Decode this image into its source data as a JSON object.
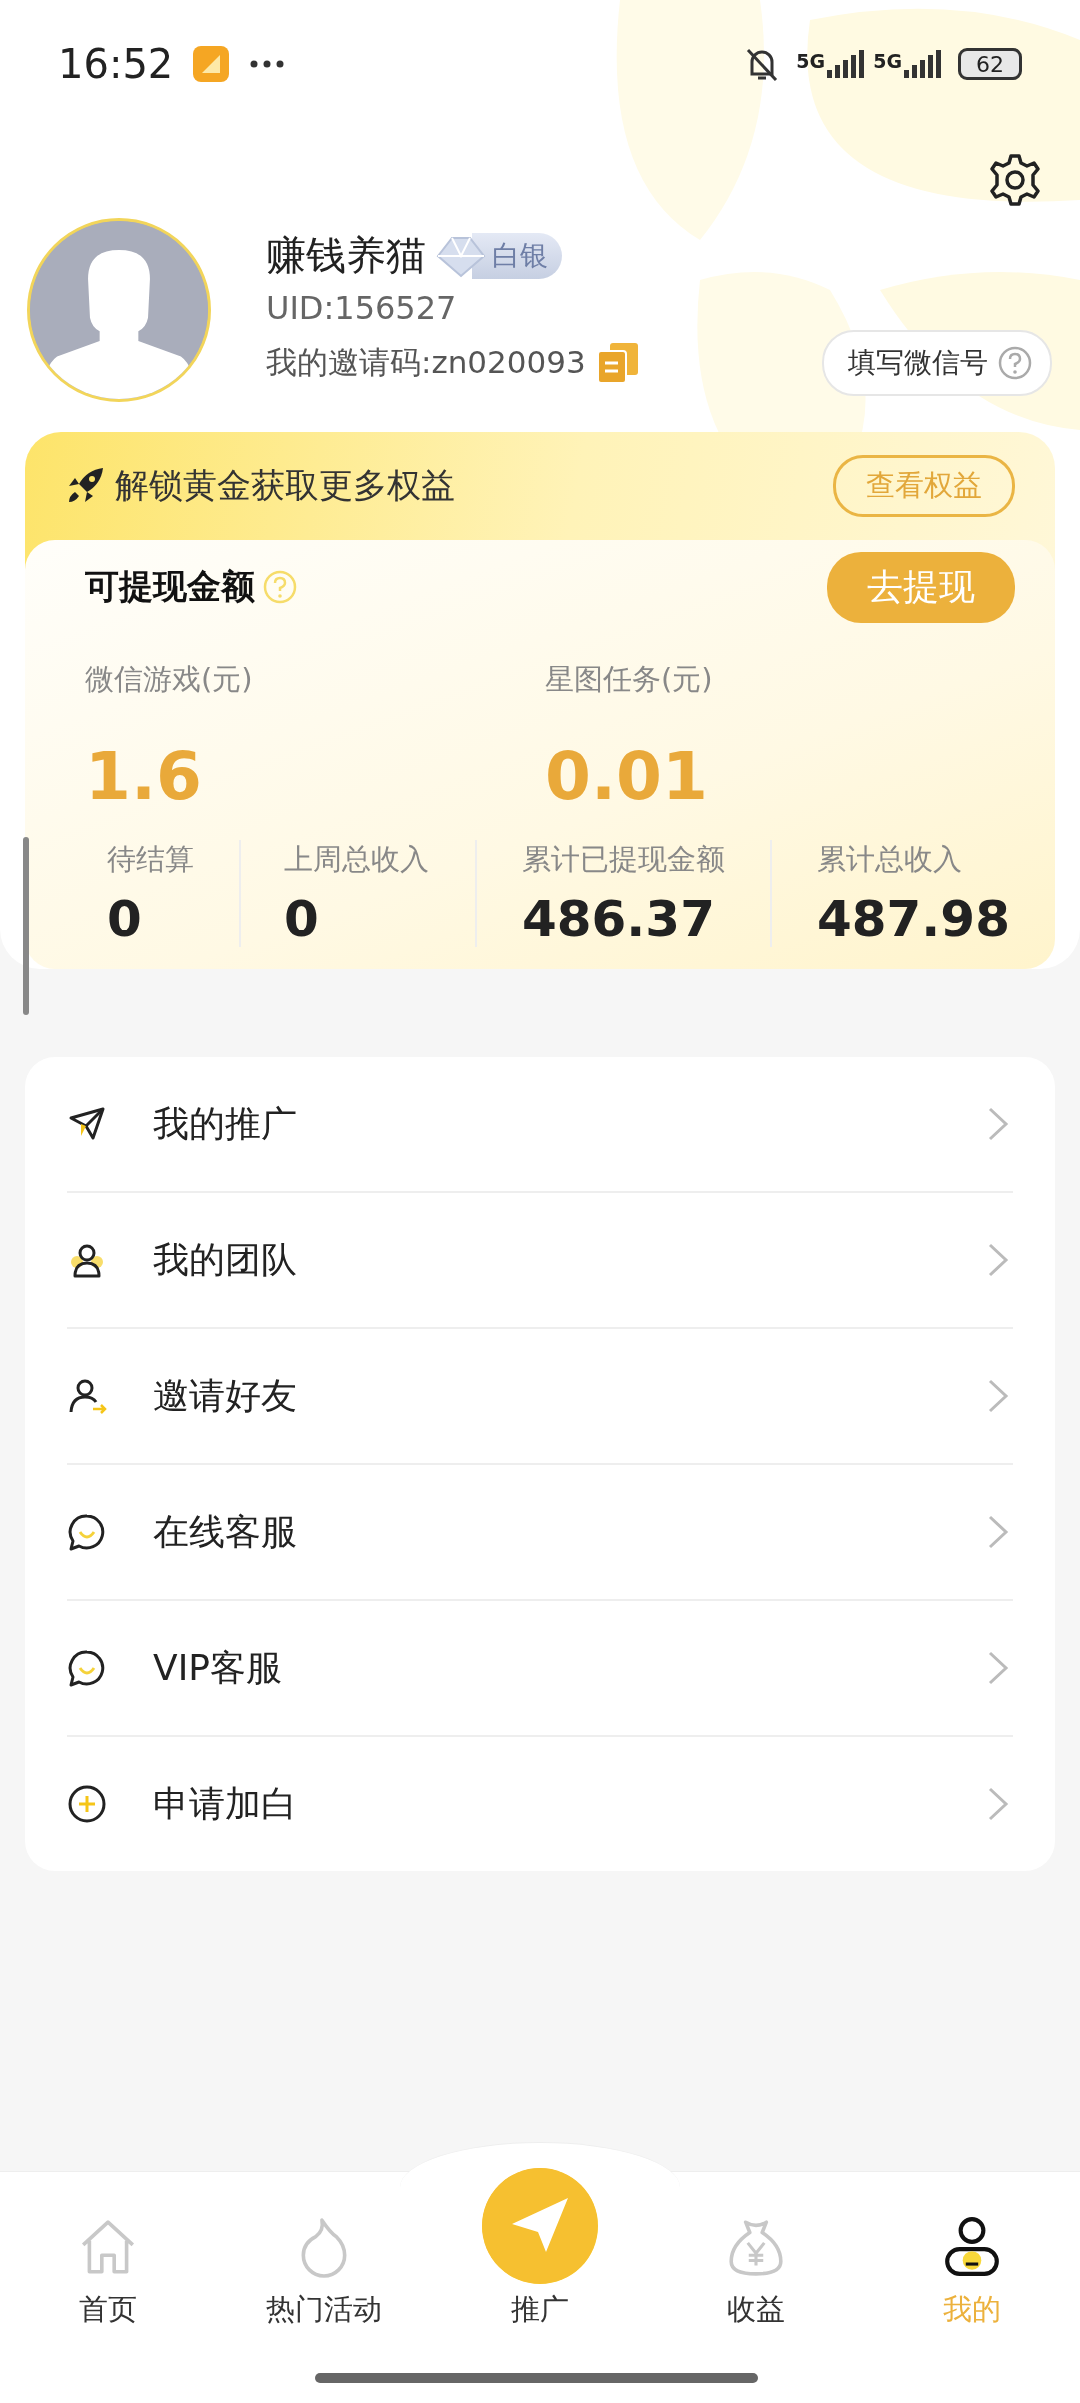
{
  "status_bar": {
    "time": "16:52",
    "networks": [
      "5G",
      "5G"
    ],
    "battery": "62"
  },
  "profile": {
    "name": "赚钱养猫",
    "badge": "白银",
    "uid": "UID:156527",
    "invite_code": "我的邀请码:zn020093",
    "wechat_button": "填写微信号"
  },
  "banner": {
    "text": "解锁黄金获取更多权益",
    "button": "查看权益"
  },
  "balance": {
    "title": "可提现金额",
    "withdraw_button": "去提现",
    "sources": [
      {
        "label": "微信游戏(元)",
        "value": "1.6"
      },
      {
        "label": "星图任务(元)",
        "value": "0.01"
      }
    ],
    "stats": [
      {
        "label": "待结算",
        "value": "0"
      },
      {
        "label": "上周总收入",
        "value": "0"
      },
      {
        "label": "累计已提现金额",
        "value": "486.37"
      },
      {
        "label": "累计总收入",
        "value": "487.98"
      }
    ]
  },
  "menu": [
    {
      "kind": "send",
      "label": "我的推广"
    },
    {
      "kind": "team",
      "label": "我的团队"
    },
    {
      "kind": "invite",
      "label": "邀请好友"
    },
    {
      "kind": "chat",
      "label": "在线客服"
    },
    {
      "kind": "chat",
      "label": "VIP客服"
    },
    {
      "kind": "plus",
      "label": "申请加白"
    }
  ],
  "nav": [
    {
      "kind": "home",
      "label": "首页",
      "selected": false
    },
    {
      "kind": "fire",
      "label": "热门活动",
      "selected": false
    },
    {
      "kind": "promo",
      "label": "推广",
      "selected": false
    },
    {
      "kind": "money",
      "label": "收益",
      "selected": false
    },
    {
      "kind": "me",
      "label": "我的",
      "selected": true
    }
  ]
}
